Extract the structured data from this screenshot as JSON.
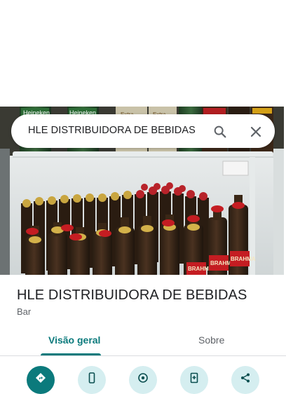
{
  "search": {
    "query": "HLE DISTRIBUIDORA DE BEBIDAS",
    "search_icon": "search-icon",
    "close_icon": "close-icon"
  },
  "photo": {
    "subject": "photo-of-beer-bottles-in-refrigerator",
    "shelf_labels": [
      "Heineken",
      "Heineken",
      "Extra",
      "Extra",
      "BRAHMA",
      "BRAHMA",
      "BRAHMA"
    ]
  },
  "place": {
    "name": "HLE DISTRIBUIDORA DE BEBIDAS",
    "category": "Bar"
  },
  "tabs": [
    {
      "label": "Visão geral",
      "active": true
    },
    {
      "label": "Sobre",
      "active": false
    }
  ],
  "actions": [
    {
      "icon": "directions-icon"
    },
    {
      "icon": "phone-icon"
    },
    {
      "icon": "nearby-icon"
    },
    {
      "icon": "save-icon"
    },
    {
      "icon": "share-icon"
    }
  ],
  "colors": {
    "accent": "#0b7a7c",
    "action_bg": "#d5eef0",
    "text_primary": "#202124",
    "text_secondary": "#5f6368"
  }
}
